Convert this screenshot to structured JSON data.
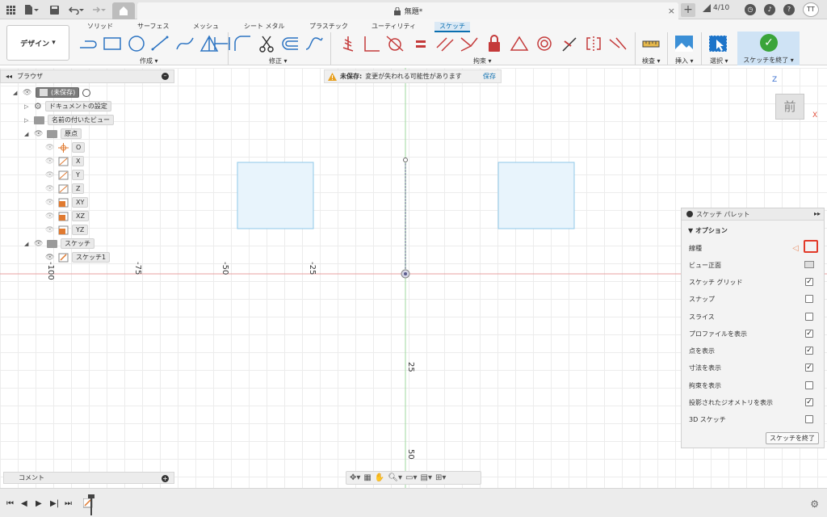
{
  "titlebar": {
    "doc_title": "無題*",
    "jobs": "4/10",
    "avatar": "TT"
  },
  "toolbar": {
    "workspace": "デザイン",
    "tabs": [
      "ソリッド",
      "サーフェス",
      "メッシュ",
      "シート メタル",
      "プラスチック",
      "ユーティリティ",
      "スケッチ"
    ],
    "groups": {
      "create": "作成",
      "modify": "修正",
      "constraints": "拘束",
      "inspect": "検査",
      "insert": "挿入",
      "select": "選択"
    },
    "finish_sketch": "スケッチを終了"
  },
  "warning": {
    "title": "未保存:",
    "message": "変更が失われる可能性があります",
    "save": "保存"
  },
  "browser": {
    "title": "ブラウザ",
    "root": "(未保存)",
    "items": {
      "doc_settings": "ドキュメントの設定",
      "named_views": "名前の付いたビュー",
      "origin": "原点",
      "o": "O",
      "x": "X",
      "y": "Y",
      "z": "Z",
      "xy": "XY",
      "xz": "XZ",
      "yz": "YZ",
      "sketches": "スケッチ",
      "sketch1": "スケッチ1"
    }
  },
  "comments": {
    "label": "コメント"
  },
  "canvas": {
    "ticks_x": [
      "-100",
      "-75",
      "-50",
      "-25"
    ],
    "ticks_y": [
      "25",
      "50"
    ],
    "viewcube_face": "前",
    "axis_z": "Z",
    "axis_x": "X"
  },
  "palette": {
    "title": "スケッチ パレット",
    "section": "オプション",
    "options": [
      {
        "label": "線種",
        "type": "linetype"
      },
      {
        "label": "ビュー正面",
        "type": "view"
      },
      {
        "label": "スケッチ グリッド",
        "checked": true
      },
      {
        "label": "スナップ",
        "checked": false
      },
      {
        "label": "スライス",
        "checked": false
      },
      {
        "label": "プロファイルを表示",
        "checked": true
      },
      {
        "label": "点を表示",
        "checked": true
      },
      {
        "label": "寸法を表示",
        "checked": true
      },
      {
        "label": "拘束を表示",
        "checked": false
      },
      {
        "label": "投影されたジオメトリを表示",
        "checked": true
      },
      {
        "label": "3D スケッチ",
        "checked": false
      }
    ],
    "finish_button": "スケッチを終了"
  }
}
